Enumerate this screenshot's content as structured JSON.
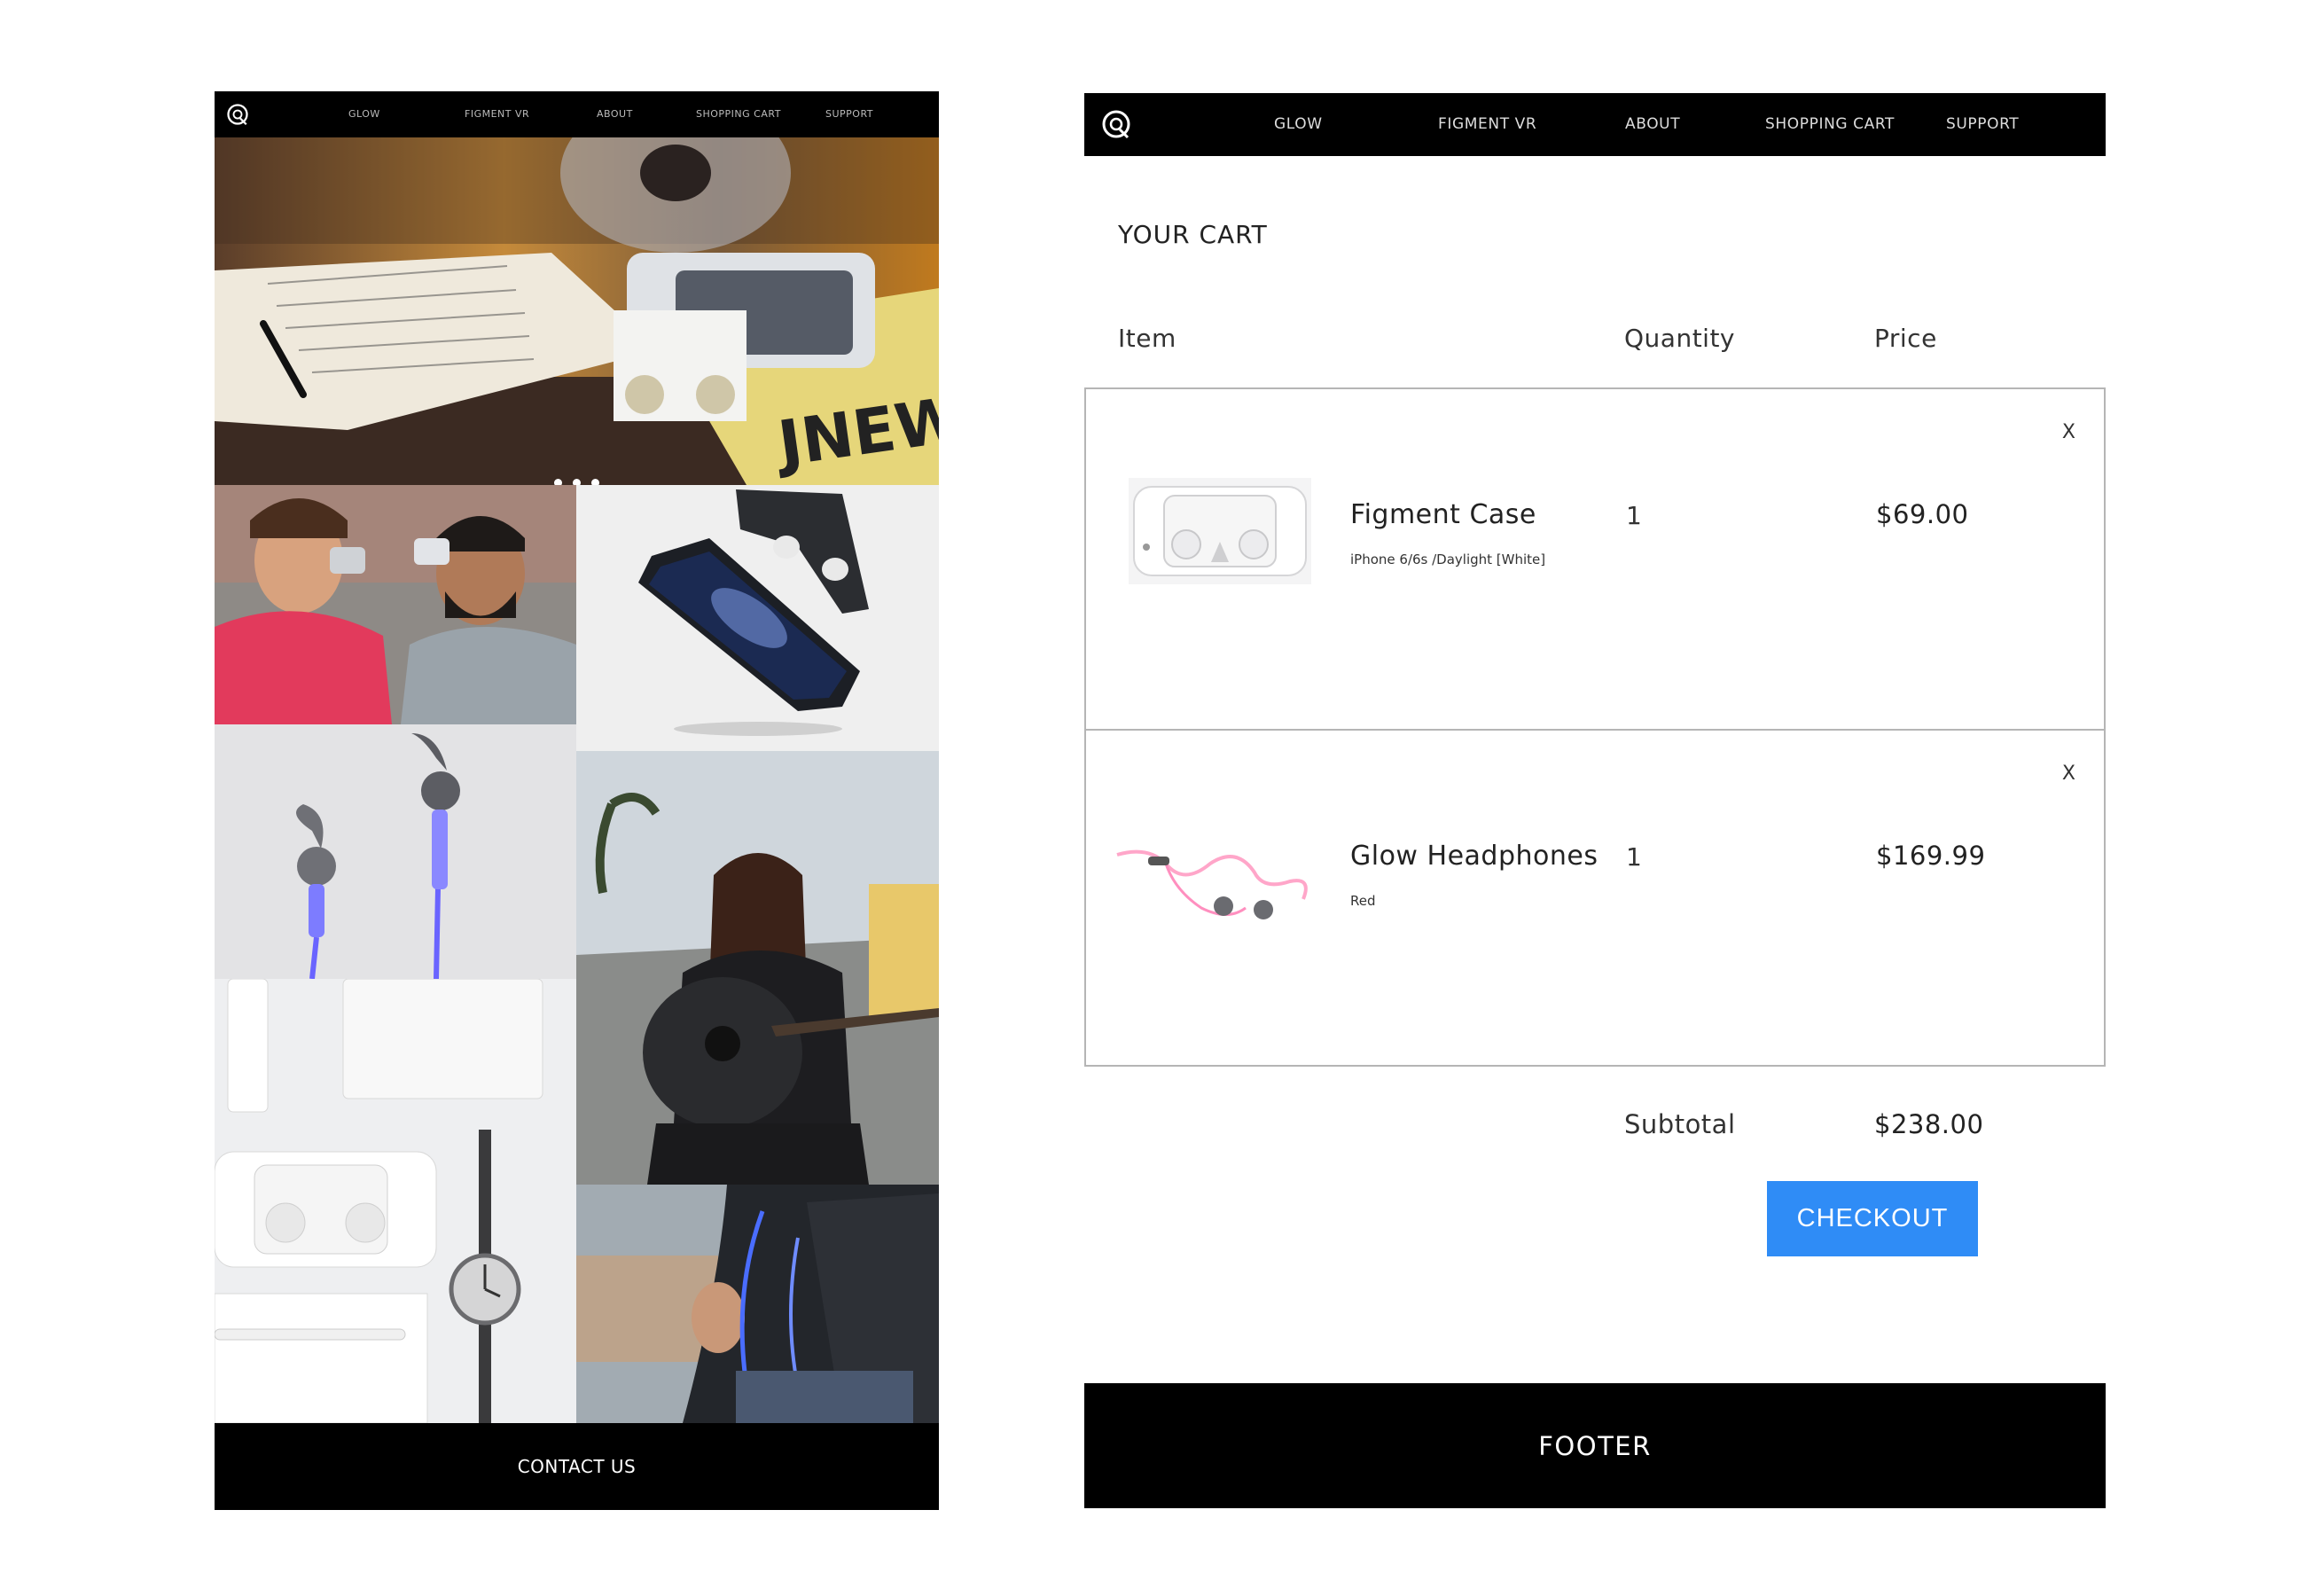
{
  "left_page": {
    "nav": {
      "items": [
        {
          "label": "GLOW"
        },
        {
          "label": "FIGMENT VR"
        },
        {
          "label": "ABOUT"
        },
        {
          "label": "SHOPPING CART"
        },
        {
          "label": "SUPPORT"
        }
      ]
    },
    "hero": {
      "carousel_slides": 3
    },
    "gallery": [
      {
        "alt": "friends using figment vr"
      },
      {
        "alt": "figment vr phone case"
      },
      {
        "alt": "glow headphones blue"
      },
      {
        "alt": "woman playing guitar"
      },
      {
        "alt": "white accessories flat lay"
      },
      {
        "alt": "man wearing glow headphones"
      }
    ],
    "contact_label": "CONTACT US"
  },
  "right_page": {
    "nav": {
      "items": [
        {
          "label": "GLOW"
        },
        {
          "label": "FIGMENT VR"
        },
        {
          "label": "ABOUT"
        },
        {
          "label": "SHOPPING CART"
        },
        {
          "label": "SUPPORT"
        }
      ]
    },
    "cart": {
      "title": "YOUR CART",
      "columns": {
        "item": "Item",
        "quantity": "Quantity",
        "price": "Price"
      },
      "items": [
        {
          "name": "Figment Case",
          "variant": "iPhone 6/6s /Daylight [White]",
          "quantity": "1",
          "price": "$69.00",
          "remove_label": "X"
        },
        {
          "name": "Glow Headphones",
          "variant": "Red",
          "quantity": "1",
          "price": "$169.99",
          "remove_label": "X"
        }
      ],
      "subtotal_label": "Subtotal",
      "subtotal_value": "$238.00",
      "checkout_label": "CHECKOUT"
    },
    "footer_label": "FOOTER"
  },
  "colors": {
    "nav_bg": "#000000",
    "checkout_bg": "#2f8cf6",
    "border": "#b5b5b5",
    "glow_blue": "#5b5bff",
    "glow_pink": "#ff8fbf"
  }
}
